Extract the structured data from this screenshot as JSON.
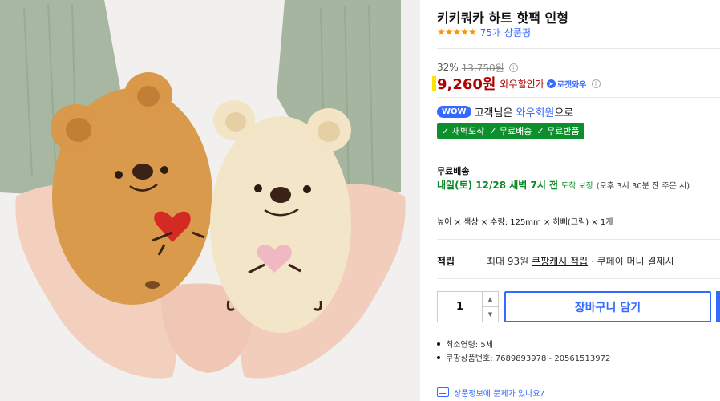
{
  "product": {
    "title": "키키쿼카 하트 핫팩 인형",
    "rating_stars": "★★★★★",
    "review_count": "75개 상품평"
  },
  "price": {
    "discount_rate": "32%",
    "original_price": "13,750원",
    "sale_price": "9,260원",
    "sale_label": "와우할인가",
    "rocket_label": "로켓와우"
  },
  "wow": {
    "badge": "WOW",
    "prefix": "고객님은",
    "member": "와우회원",
    "suffix": "으로"
  },
  "perks": [
    "새벽도착",
    "무료배송",
    "무료반품"
  ],
  "shipping": {
    "label": "무료배송",
    "eta": "내일(토) 12/28 새벽 7시 전",
    "guarantee": "도착 보장",
    "note": "(오후 3시 30분 전 주문 시)"
  },
  "option_summary": "높이 × 색상 × 수량: 125mm × 하뻐(크림) × 1개",
  "points": {
    "label": "적립",
    "prefix": "최대 93원",
    "link": "쿠팡캐시 적립",
    "suffix": "· 쿠페이 머니 결제시"
  },
  "cart": {
    "quantity": "1",
    "add_to_cart": "장바구니 담기"
  },
  "meta": {
    "min_age": "최소연령: 5세",
    "product_number": "쿠팡상품번호: 7689893978 - 20561513972"
  },
  "report_link": "상품정보에 문제가 있나요?",
  "colors": {
    "brand_blue": "#346aff",
    "price_red": "#ae0000",
    "perk_green": "#0d8f2e",
    "star_orange": "#ff9600"
  }
}
